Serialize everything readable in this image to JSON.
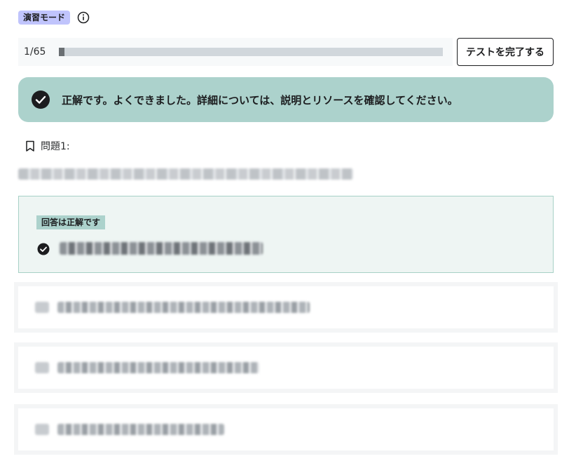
{
  "header": {
    "mode_label": "演習モード",
    "info_icon": "info-icon"
  },
  "progress": {
    "counter": "1/65",
    "fraction": 0.0154,
    "finish_button_label": "テストを完了する"
  },
  "result": {
    "icon": "check-circle-icon",
    "message": "正解です。よくできました。詳細については、説明とリソースを確認してください。"
  },
  "question": {
    "bookmark_icon": "bookmark-icon",
    "label": "問題1:"
  },
  "answers": {
    "correct_badge": "回答は正解です",
    "correct_icon": "check-circle-icon"
  },
  "colors": {
    "accent_green": "#acd2cc",
    "mode_badge": "#c0c4fc",
    "correct_bg": "#eef5f3",
    "correct_border": "#a7d1c6"
  }
}
